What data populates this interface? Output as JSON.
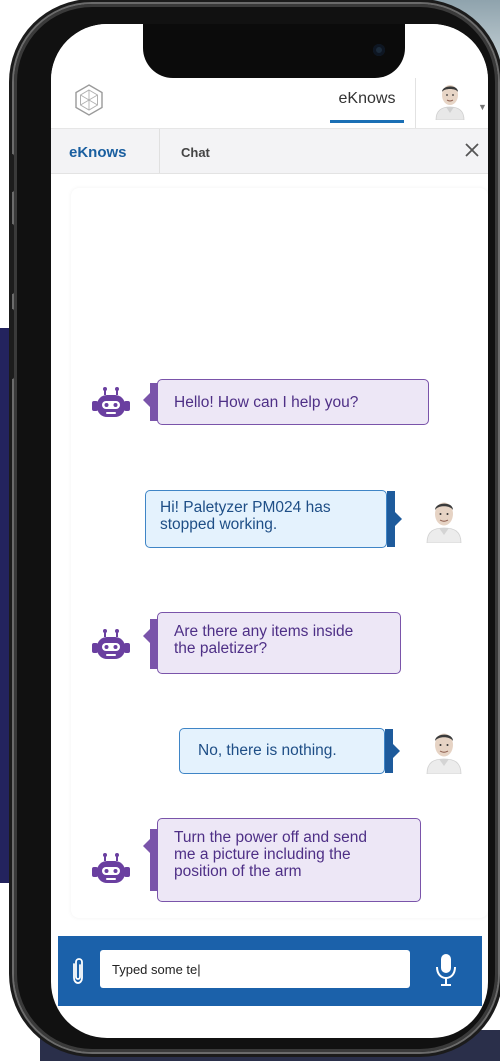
{
  "header": {
    "tab_eknows": "eKnows"
  },
  "subtabs": {
    "eknows": "eKnows",
    "chat": "Chat"
  },
  "messages": [
    {
      "from": "bot",
      "lines": [
        "Hello! How can I help you?"
      ]
    },
    {
      "from": "user",
      "lines": [
        "Hi! Paletyzer PM024 has",
        "stopped working."
      ]
    },
    {
      "from": "bot",
      "lines": [
        "Are there any items inside",
        "the paletizer?"
      ]
    },
    {
      "from": "user",
      "lines": [
        "No, there is nothing."
      ]
    },
    {
      "from": "bot",
      "lines": [
        "Turn the power off and send",
        "me a picture including the",
        "position of the arm"
      ]
    }
  ],
  "input": {
    "value": "Typed some te|"
  },
  "colors": {
    "accent_blue": "#1b61aa",
    "bot_purple": "#7a54aa",
    "bot_bubble_bg": "#ede7f6",
    "user_bubble_bg": "#e4f2fd",
    "navy_background": "#23235e"
  },
  "icons": [
    "logo-icon",
    "avatar-icon",
    "close-icon",
    "bot-icon",
    "paperclip-icon",
    "microphone-icon"
  ]
}
